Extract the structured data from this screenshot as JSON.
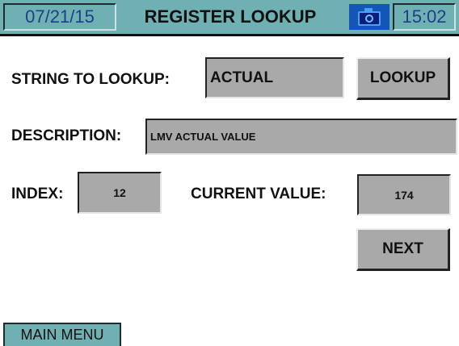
{
  "header": {
    "date": "07/21/15",
    "title": "REGISTER LOOKUP",
    "time": "15:02",
    "camera_icon": "camera-icon"
  },
  "form": {
    "string_label": "STRING TO LOOKUP:",
    "string_value": "ACTUAL",
    "lookup_button": "LOOKUP",
    "description_label": "DESCRIPTION:",
    "description_value": "LMV ACTUAL VALUE",
    "index_label": "INDEX:",
    "index_value": "12",
    "current_value_label": "CURRENT VALUE:",
    "current_value": "174",
    "next_button": "NEXT"
  },
  "footer": {
    "main_menu": "MAIN MENU"
  },
  "colors": {
    "header_bg": "#6fb0b3",
    "field_bg": "#a9a9a9",
    "text_blue": "#1f3f8a",
    "camera_bg": "#1456b8"
  }
}
